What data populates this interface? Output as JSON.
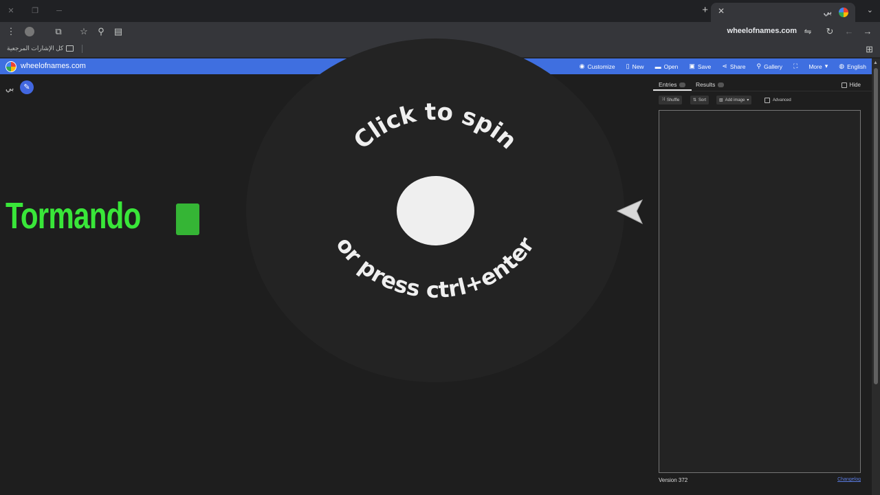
{
  "browser": {
    "tab_title": "بي",
    "url": "wheelofnames.com",
    "bookmarks_label": "كل الإشارات المرجعية"
  },
  "header": {
    "site_name": "wheelofnames.com",
    "nav": {
      "customize": "Customize",
      "new": "New",
      "open": "Open",
      "save": "Save",
      "share": "Share",
      "gallery": "Gallery",
      "more": "More",
      "language": "English"
    }
  },
  "wheel": {
    "user_tag": "بي",
    "top_text": "Click to spin",
    "bottom_text": "or press ctrl+enter"
  },
  "overlay": {
    "stream_text": "Tormando"
  },
  "panel": {
    "tab_entries": "Entries",
    "tab_results": "Results",
    "hide_label": "Hide",
    "shuffle": "Shuffle",
    "sort": "Sort",
    "add_image": "Add image",
    "advanced": "Advanced",
    "version": "Version 372",
    "changelog": "Changelog"
  },
  "colors": {
    "header_blue": "#3f6fe0",
    "stream_green": "#39e639"
  }
}
